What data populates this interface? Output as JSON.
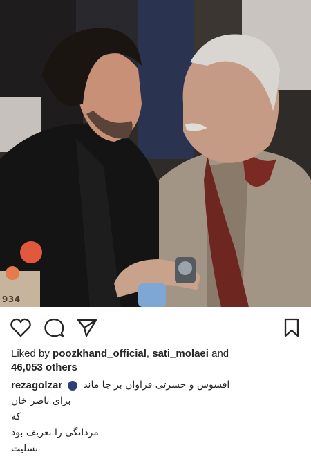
{
  "photo": {
    "number": "934"
  },
  "actions": {
    "like_icon": "heart-icon",
    "comment_icon": "comment-icon",
    "share_icon": "send-icon",
    "save_icon": "bookmark-icon"
  },
  "likes": {
    "prefix": "Liked by ",
    "user1": "poozkhand_official",
    "separator": ", ",
    "user2": "sati_molaei",
    "and": " and",
    "count": "46,053 others"
  },
  "caption": {
    "username": "rezagolzar",
    "line1": "افسوس و حسرتی فراوان بر جا ماند",
    "line2": "برای ناصر خان",
    "line3": "که",
    "line4": "مردانگی را تعریف بود",
    "line5": "تسلیت"
  },
  "colors": {
    "text": "#262626",
    "dot": "#2e3f73"
  }
}
